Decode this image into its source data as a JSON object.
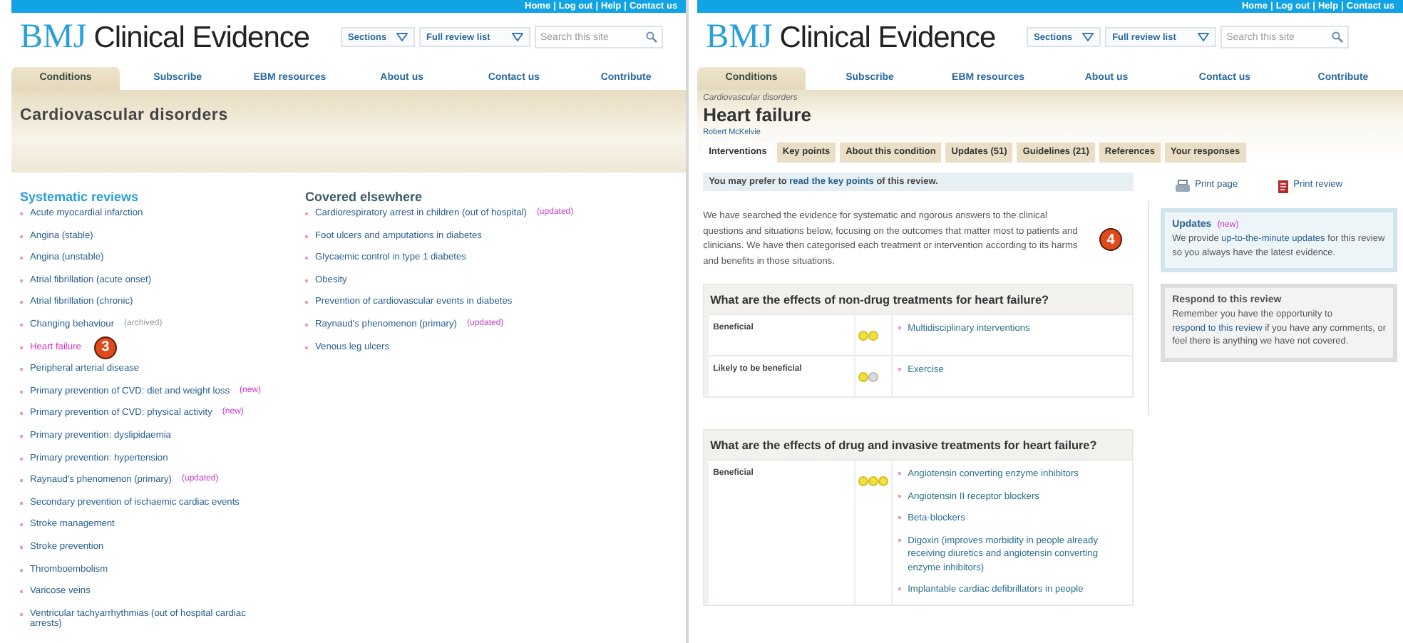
{
  "left_page": {
    "header": {
      "top_links": [
        "Home",
        "Log out",
        "Help",
        "Contact us"
      ],
      "separator": "|",
      "logo": {
        "mark": "BMJ",
        "name": "Clinical Evidence"
      },
      "sections_menu": "Sections",
      "review_list_menu": "Full review list",
      "search": {
        "placeholder": "Search this site"
      }
    },
    "nav": [
      {
        "label": "Conditions",
        "selected": true
      },
      {
        "label": "Subscribe",
        "selected": false
      },
      {
        "label": "EBM resources",
        "selected": false
      },
      {
        "label": "About us",
        "selected": false
      },
      {
        "label": "Contact us",
        "selected": false
      },
      {
        "label": "Contribute",
        "selected": false
      }
    ],
    "band_title": "Cardiovascular disorders",
    "systematic_reviews": {
      "heading": "Systematic reviews",
      "items": [
        {
          "label": "Acute myocardial infarction",
          "selected": false
        },
        {
          "label": "Angina (stable)",
          "selected": false
        },
        {
          "label": "Angina (unstable)",
          "selected": false
        },
        {
          "label": "Atrial fibrillation (acute onset)",
          "selected": false
        },
        {
          "label": "Atrial fibrillation (chronic)",
          "selected": false
        },
        {
          "label": "Changing behaviour",
          "tag": "(archived)",
          "kind": "archived",
          "selected": false
        },
        {
          "label": "Heart failure",
          "selected": true,
          "callout": "3"
        },
        {
          "label": "Peripheral arterial disease",
          "selected": false
        },
        {
          "label": "Primary prevention of CVD: diet and weight loss",
          "tag": "(new)",
          "kind": "new",
          "selected": false
        },
        {
          "label": "Primary prevention of CVD: physical activity",
          "tag": "(new)",
          "kind": "new",
          "selected": false
        },
        {
          "label": "Primary prevention: dyslipidaemia",
          "selected": false
        },
        {
          "label": "Primary prevention: hypertension",
          "selected": false
        },
        {
          "label": "Raynaud's phenomenon (primary)",
          "tag": "(updated)",
          "kind": "updated",
          "selected": false
        },
        {
          "label": "Secondary prevention of ischaemic cardiac events",
          "selected": false
        },
        {
          "label": "Stroke management",
          "selected": false
        },
        {
          "label": "Stroke prevention",
          "selected": false
        },
        {
          "label": "Thromboembolism",
          "selected": false
        },
        {
          "label": "Varicose veins",
          "selected": false
        },
        {
          "label": "Ventricular tachyarrhythmias (out of hospital cardiac arrests)",
          "selected": false
        }
      ]
    },
    "covered_elsewhere": {
      "heading": "Covered elsewhere",
      "items": [
        {
          "label": "Cardiorespiratory arrest in children (out of hospital)",
          "tag": "(updated)",
          "kind": "updated",
          "selected": false
        },
        {
          "label": "Foot ulcers and amputations in diabetes",
          "selected": false
        },
        {
          "label": "Glycaemic control in type 1 diabetes",
          "selected": false
        },
        {
          "label": "Obesity",
          "selected": false
        },
        {
          "label": "Prevention of cardiovascular events in diabetes",
          "selected": false
        },
        {
          "label": "Raynaud's phenomenon (primary)",
          "tag": "(updated)",
          "kind": "updated",
          "selected": false
        },
        {
          "label": "Venous leg ulcers",
          "selected": false
        }
      ]
    }
  },
  "right_page": {
    "header": {
      "top_links": [
        "Home",
        "Log out",
        "Help",
        "Contact us"
      ],
      "separator": "|",
      "logo": {
        "mark": "BMJ",
        "name": "Clinical Evidence"
      },
      "sections_menu": "Sections",
      "review_list_menu": "Full review list",
      "search": {
        "placeholder": "Search this site"
      }
    },
    "nav": [
      {
        "label": "Conditions",
        "selected": true
      },
      {
        "label": "Subscribe",
        "selected": false
      },
      {
        "label": "EBM resources",
        "selected": false
      },
      {
        "label": "About us",
        "selected": false
      },
      {
        "label": "Contact us",
        "selected": false
      },
      {
        "label": "Contribute",
        "selected": false
      }
    ],
    "breadcrumb": "Cardiovascular disorders",
    "title": "Heart failure",
    "author": "Robert McKelvie",
    "tabs": [
      {
        "label": "Interventions",
        "selected": true
      },
      {
        "label": "Key points",
        "selected": false
      },
      {
        "label": "About this condition",
        "selected": false
      },
      {
        "label": "Updates (51)",
        "selected": false
      },
      {
        "label": "Guidelines (21)",
        "selected": false
      },
      {
        "label": "References",
        "selected": false
      },
      {
        "label": "Your responses",
        "selected": false
      }
    ],
    "notice": {
      "before": "You may prefer to",
      "link": "read the key points",
      "after": "of this review."
    },
    "intro": {
      "text": "We have searched the evidence for systematic and rigorous answers to the clinical questions and situations below, focusing on the outcomes that matter most to patients and clinicians. We have then categorised each treatment or intervention according to its harms and benefits in those situations.",
      "callout": "4"
    },
    "questions": [
      {
        "question": "What are the effects of non-drug treatments for heart failure?",
        "rows": [
          {
            "category": "Beneficial",
            "rating": [
              {
                "filled": true
              },
              {
                "filled": true
              }
            ],
            "items": [
              "Multidisciplinary interventions"
            ]
          },
          {
            "category": "Likely to be beneficial",
            "rating": [
              {
                "filled": true
              },
              {
                "filled": false
              }
            ],
            "items": [
              "Exercise"
            ]
          }
        ]
      },
      {
        "question": "What are the effects of drug and invasive treatments for heart failure?",
        "rows": [
          {
            "category": "Beneficial",
            "rating": [
              {
                "filled": true
              },
              {
                "filled": true
              },
              {
                "filled": true
              }
            ],
            "items": [
              "Angiotensin converting enzyme inhibitors",
              "Angiotensin II receptor blockers",
              "Beta-blockers",
              "Digoxin (improves morbidity in people already receiving diuretics and angiotensin converting enzyme inhibitors)",
              "Implantable cardiac defibrillators in people"
            ]
          }
        ]
      }
    ],
    "print_links": [
      {
        "kind": "page",
        "label": "Print page"
      },
      {
        "kind": "review",
        "label": "Print review"
      }
    ],
    "updates_box": {
      "title": "Updates",
      "tag": "(new)",
      "before": "We provide",
      "link": "up-to-the-minute updates",
      "after": "for this review so you always have the latest evidence."
    },
    "respond_box": {
      "title": "Respond to this review",
      "before": "Remember you have the opportunity to",
      "link": "respond to this review",
      "after": "if you have any comments, or feel there is anything we have not covered."
    }
  }
}
